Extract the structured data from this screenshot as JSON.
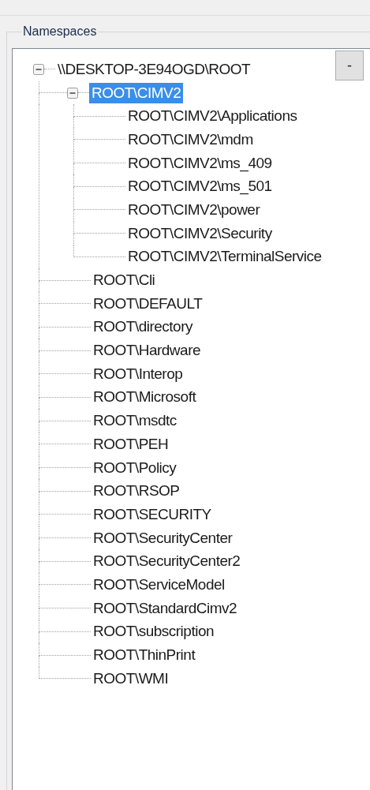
{
  "group_title": "Namespaces",
  "side_button": "-",
  "tree": {
    "label": "\\\\DESKTOP-3E94OGD\\ROOT",
    "expanded": true,
    "selected": false,
    "children": [
      {
        "label": "ROOT\\CIMV2",
        "expanded": true,
        "selected": true,
        "children": [
          {
            "label": "ROOT\\CIMV2\\Applications",
            "selected": false
          },
          {
            "label": "ROOT\\CIMV2\\mdm",
            "selected": false
          },
          {
            "label": "ROOT\\CIMV2\\ms_409",
            "selected": false
          },
          {
            "label": "ROOT\\CIMV2\\ms_501",
            "selected": false
          },
          {
            "label": "ROOT\\CIMV2\\power",
            "selected": false
          },
          {
            "label": "ROOT\\CIMV2\\Security",
            "selected": false
          },
          {
            "label": "ROOT\\CIMV2\\TerminalService",
            "selected": false
          }
        ]
      },
      {
        "label": "ROOT\\Cli",
        "selected": false
      },
      {
        "label": "ROOT\\DEFAULT",
        "selected": false
      },
      {
        "label": "ROOT\\directory",
        "selected": false
      },
      {
        "label": "ROOT\\Hardware",
        "selected": false
      },
      {
        "label": "ROOT\\Interop",
        "selected": false
      },
      {
        "label": "ROOT\\Microsoft",
        "selected": false
      },
      {
        "label": "ROOT\\msdtc",
        "selected": false
      },
      {
        "label": "ROOT\\PEH",
        "selected": false
      },
      {
        "label": "ROOT\\Policy",
        "selected": false
      },
      {
        "label": "ROOT\\RSOP",
        "selected": false
      },
      {
        "label": "ROOT\\SECURITY",
        "selected": false
      },
      {
        "label": "ROOT\\SecurityCenter",
        "selected": false
      },
      {
        "label": "ROOT\\SecurityCenter2",
        "selected": false
      },
      {
        "label": "ROOT\\ServiceModel",
        "selected": false
      },
      {
        "label": "ROOT\\StandardCimv2",
        "selected": false
      },
      {
        "label": "ROOT\\subscription",
        "selected": false
      },
      {
        "label": "ROOT\\ThinPrint",
        "selected": false
      },
      {
        "label": "ROOT\\WMI",
        "selected": false
      }
    ]
  }
}
